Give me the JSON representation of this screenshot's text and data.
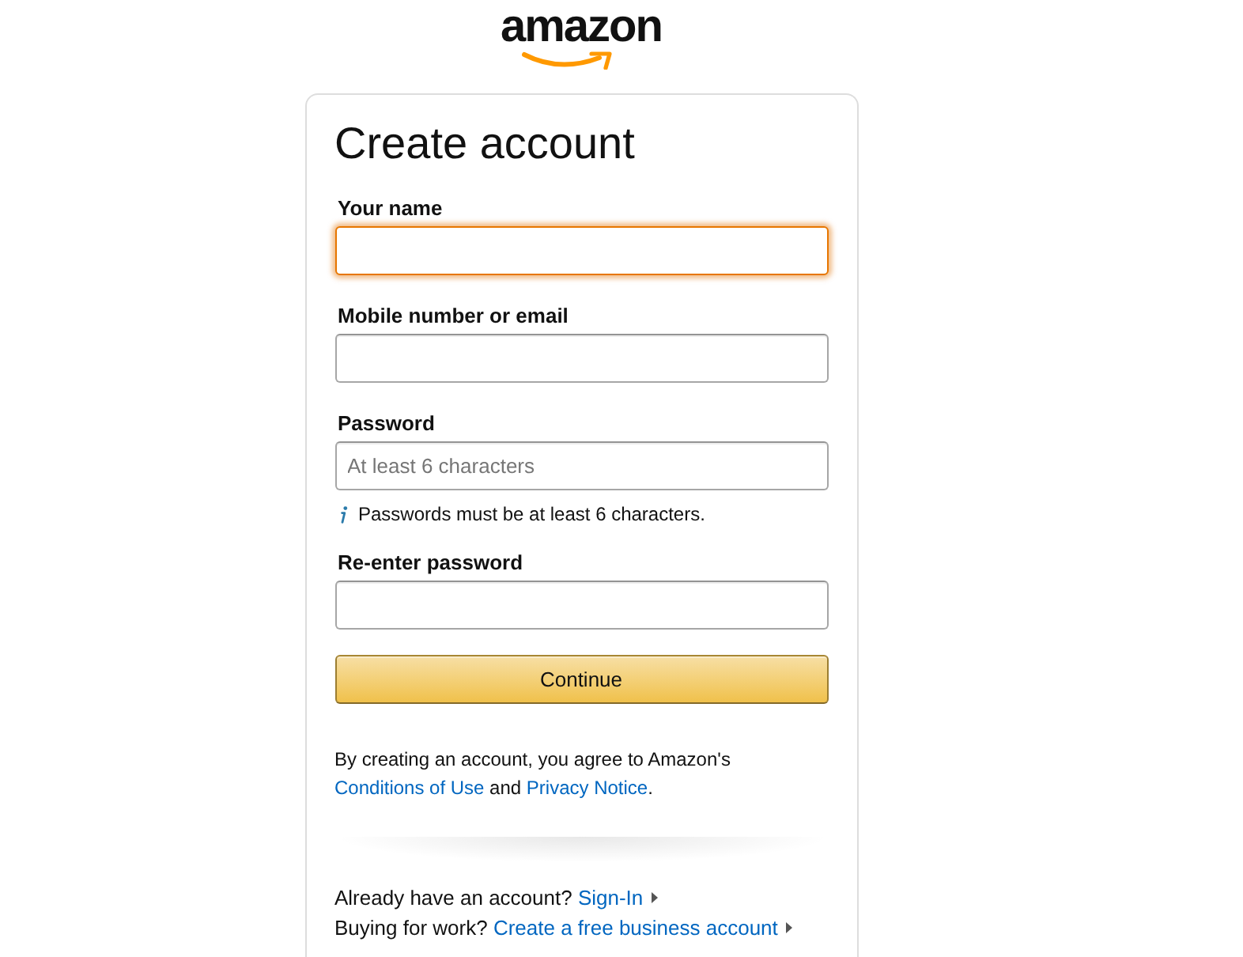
{
  "logo": {
    "text": "amazon"
  },
  "form": {
    "title": "Create account",
    "fields": [
      {
        "label": "Your name",
        "focused": true
      },
      {
        "label": "Mobile number or email",
        "focused": false
      },
      {
        "label": "Password",
        "focused": false,
        "placeholder": "At least 6 characters",
        "hint": "Passwords must be at least 6 characters."
      },
      {
        "label": "Re-enter password",
        "focused": false
      }
    ],
    "submit": "Continue",
    "legal": [
      {
        "kind": "text",
        "text": "By creating an account, you agree to Amazon's "
      },
      {
        "kind": "link",
        "text": "Conditions of Use"
      },
      {
        "kind": "text",
        "text": " and "
      },
      {
        "kind": "link",
        "text": "Privacy Notice"
      },
      {
        "kind": "text",
        "text": "."
      }
    ]
  },
  "footer": [
    {
      "prompt": "Already have an account?",
      "link": "Sign-In"
    },
    {
      "prompt": "Buying for work?",
      "link": "Create a free business account"
    }
  ]
}
